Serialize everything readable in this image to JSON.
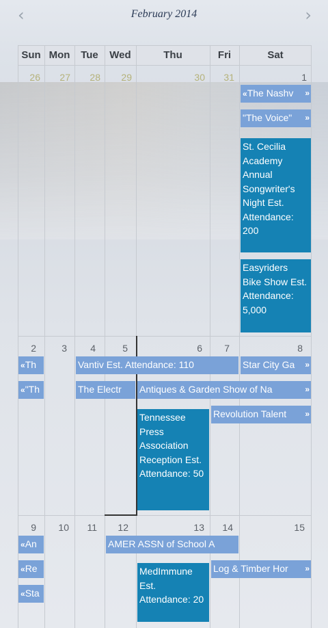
{
  "header": {
    "title": "February 2014",
    "prev_icon": "‹",
    "next_icon": "›"
  },
  "days_of_week": [
    "Sun",
    "Mon",
    "Tue",
    "Wed",
    "Thu",
    "Fri",
    "Sat"
  ],
  "weeks": [
    {
      "days": [
        "26",
        "27",
        "28",
        "29",
        "30",
        "31",
        "1"
      ]
    },
    {
      "days": [
        "2",
        "3",
        "4",
        "5",
        "6",
        "7",
        "8"
      ]
    },
    {
      "days": [
        "9",
        "10",
        "11",
        "12",
        "13",
        "14",
        "15"
      ]
    }
  ],
  "events": {
    "w1_sat_1": "The Nashv",
    "w1_sat_2": "\"The Voice\"",
    "w1_sat_3": "St. Cecilia Academy Annual Songwriter's Night Est. Attendance: 200",
    "w1_sat_4": "Easyriders Bike Show Est. Attendance: 5,000",
    "w2_sun_1": "Th",
    "w2_sun_2": "\"Th",
    "w2_vantiv": "Vantiv Est. Attendance: 110",
    "w2_starcity": "Star City Ga",
    "w2_electr": "The Electr",
    "w2_antiques": "Antiques & Garden Show of Na",
    "w2_tennessee": "Tennessee Press Association Reception Est. Attendance: 50",
    "w2_revolution": "Revolution Talent",
    "w3_sun_1": "An",
    "w3_sun_2": "Re",
    "w3_sun_3": "Sta",
    "w3_amer": "AMER ASSN of School A",
    "w3_log": "Log & Timber Hor",
    "w3_medimmune": "MedImmune Est. Attendance: 20"
  },
  "icons": {
    "arrow_left": "«",
    "arrow_right": "»"
  },
  "colors": {
    "event_light": "#7aa2d8",
    "event_dark": "#1582b4",
    "other_month_day": "#b5b27a"
  }
}
